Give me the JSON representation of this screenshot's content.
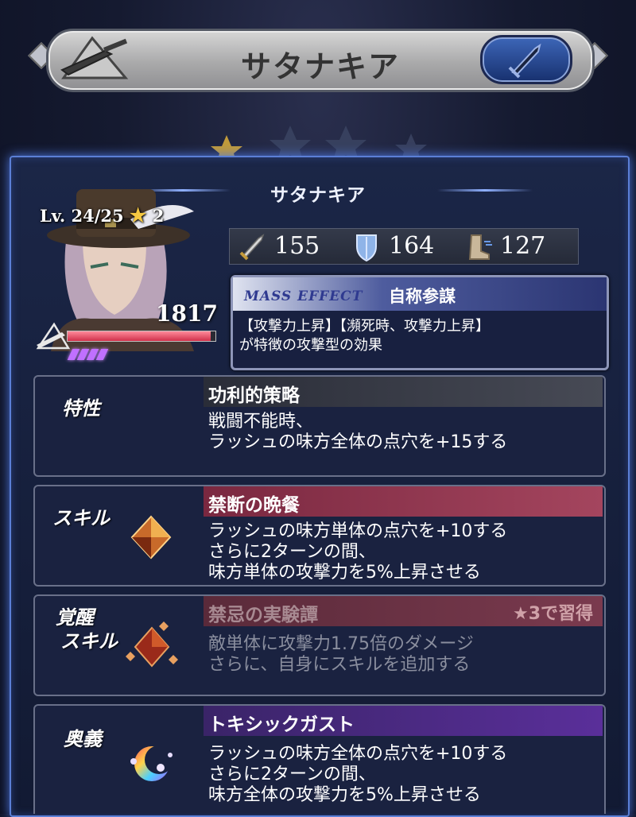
{
  "header": {
    "title": "サタナキア"
  },
  "character": {
    "name": "サタナキア",
    "level": "Lv. 24/25",
    "stars": "2",
    "hp": "1817",
    "hp_fill": 0.97,
    "gauge_count": 4
  },
  "stats": [
    {
      "icon": "sword-icon",
      "value": "155"
    },
    {
      "icon": "shield-icon",
      "value": "164"
    },
    {
      "icon": "boot-icon",
      "value": "127"
    }
  ],
  "mass_effect": {
    "label": "MASS EFFECT",
    "name": "自称参謀",
    "desc_line1": "【攻撃力上昇】【瀕死時、攻撃力上昇】",
    "desc_line2": "が特徴の攻撃型の効果"
  },
  "trait": {
    "label": "特性",
    "title": "功利的策略",
    "line1": "戦闘不能時、",
    "line2": "ラッシュの味方全体の点穴を+15する"
  },
  "skill": {
    "label": "スキル",
    "title": "禁断の晩餐",
    "line1": "ラッシュの味方単体の点穴を+10する",
    "line2": "さらに2ターンの間、",
    "line3": "味方単体の攻撃力を5%上昇させる"
  },
  "awaken": {
    "label_line1": "覚醒",
    "label_line2": "スキル",
    "title": "禁忌の実験譚",
    "learn_note": "★3で習得",
    "line1": "敵単体に攻撃力1.75倍のダメージ",
    "line2": "さらに、自身にスキルを追加する"
  },
  "ougi": {
    "label": "奥義",
    "title": "トキシックガスト",
    "line1": "ラッシュの味方全体の点穴を+10する",
    "line2": "さらに2ターンの間、",
    "line3": "味方全体の攻撃力を5%上昇させる"
  },
  "colors": {
    "panel_glow": "#5b7fd6",
    "skill_head": "#9c3a55",
    "awaken_head": "#5a3545",
    "ougi_head": "#4a2a80",
    "trait_head": "#3a3d48"
  }
}
